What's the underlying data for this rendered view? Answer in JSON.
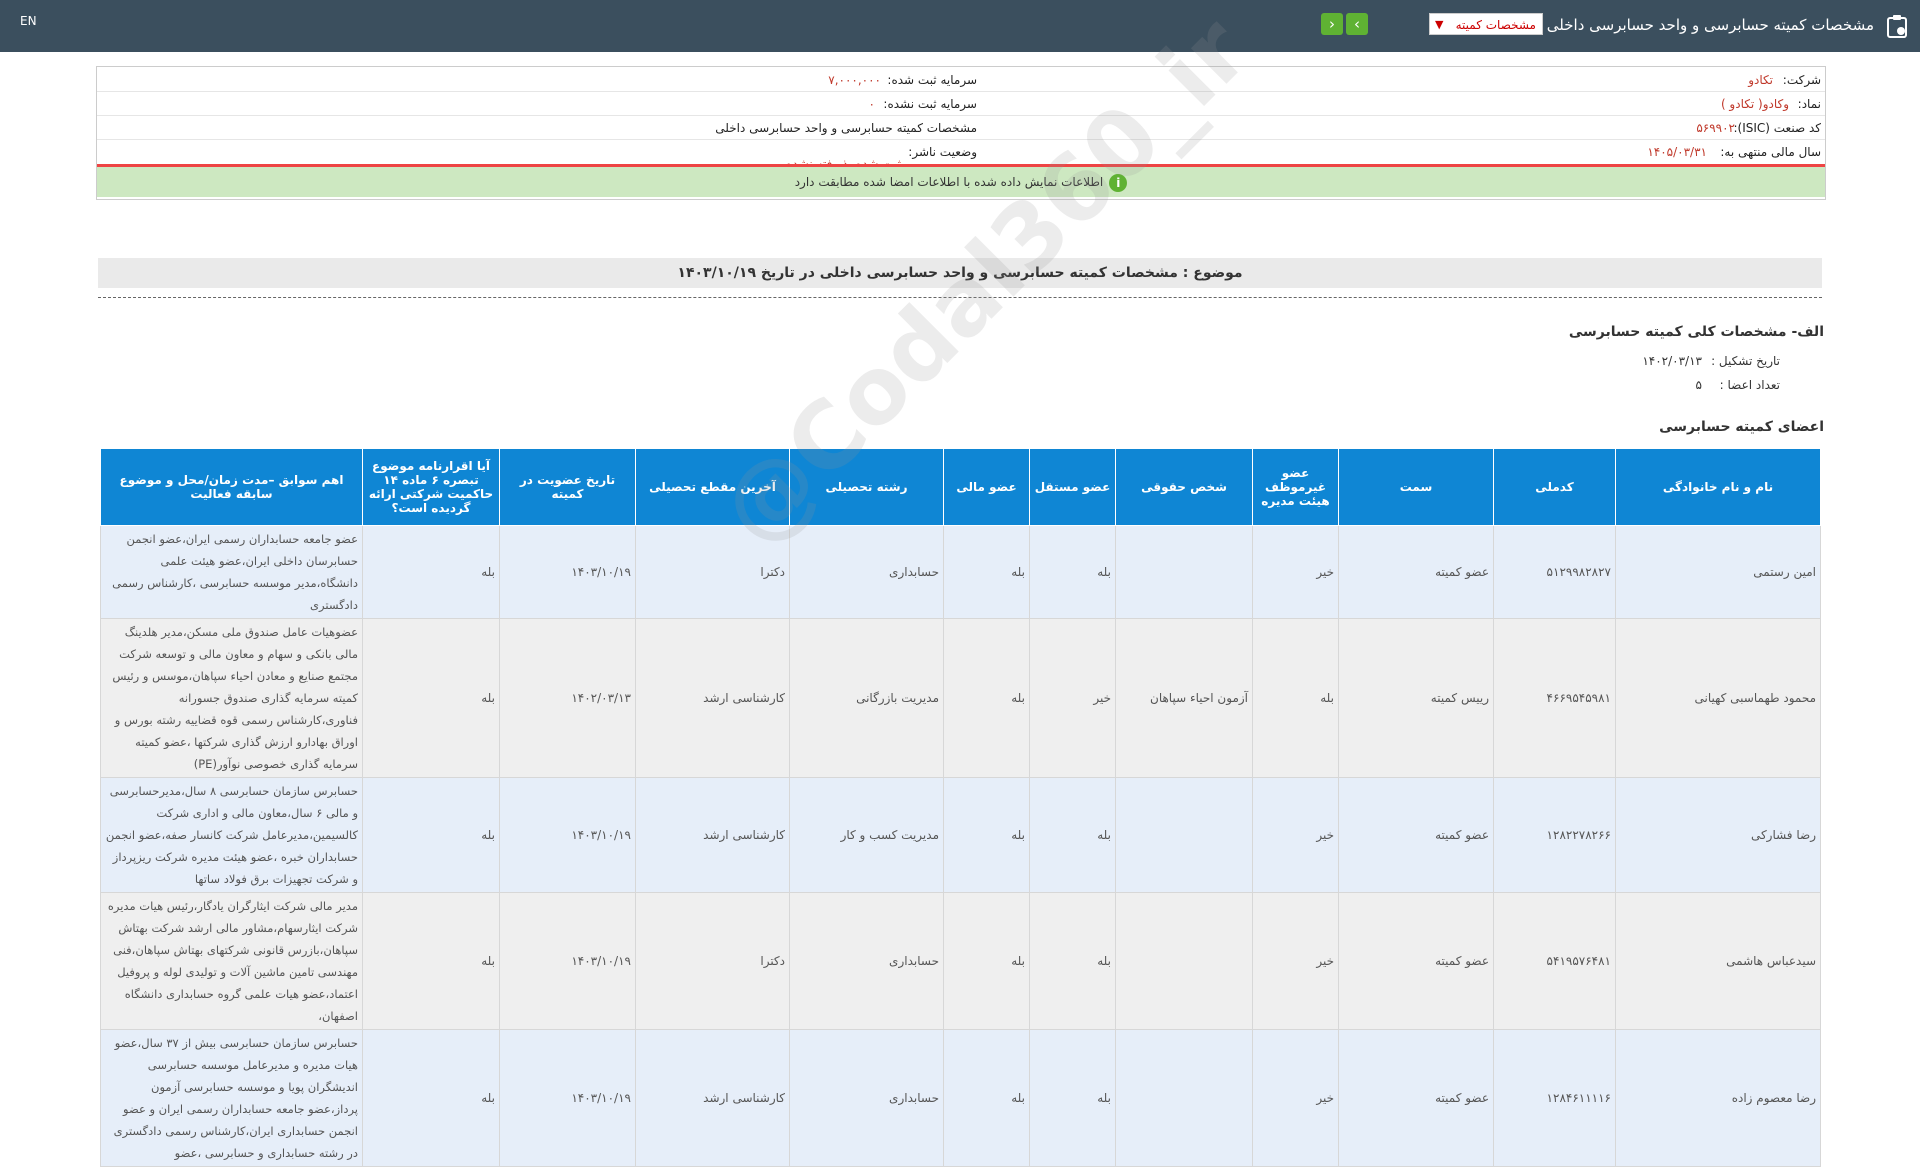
{
  "topbar": {
    "title": "مشخصات کمیته حسابرسی و واحد حسابرسی داخلی",
    "selector": "مشخصات کمیته",
    "lang": "EN"
  },
  "info": {
    "company_label": "شرکت:",
    "company_value": "تکادو",
    "symbol_label": "نماد:",
    "symbol_value": "وکادو( تکادو )",
    "isic_label": "کد صنعت (ISIC):",
    "isic_value": "۵۶۹۹۰۲",
    "fiscal_label": "سال مالی منتهی به:",
    "fiscal_value": "۱۴۰۵/۰۳/۳۱",
    "reg_capital_label": "سرمایه ثبت شده:",
    "reg_capital_value": "۷,۰۰۰,۰۰۰",
    "unreg_capital_label": "سرمایه ثبت نشده:",
    "unreg_capital_value": "۰",
    "report_type": "مشخصات کمیته حسابرسی و واحد حسابرسی داخلی",
    "publisher_status_label": "وضعیت ناشر:",
    "publisher_status_value": "ثبت شده پذیرفته نشده",
    "notice": "اطلاعات نمایش داده شده با اطلاعات امضا شده مطابقت دارد"
  },
  "subject": "موضوع : مشخصات کمیته حسابرسی و واحد حسابرسی داخلی در تاریخ ۱۴۰۳/۱۰/۱۹",
  "section_a": {
    "title": "الف- مشخصات کلی کمیته حسابرسی",
    "formation_label": "تاریخ تشکیل :",
    "formation_value": "۱۴۰۲/۰۳/۱۳",
    "members_count_label": "تعداد اعضا :",
    "members_count_value": "۵"
  },
  "section_b_title": "اعضای کمیته حسابرسی",
  "watermark": "@Codal360_ir",
  "table": {
    "headers": [
      "نام و نام خانوادگی",
      "کدملی",
      "سمت",
      "عضو غیرموظف هیئت مدیره",
      "شخص حقوقی",
      "عضو مستقل",
      "عضو مالی",
      "رشته تحصیلی",
      "آخرین مقطع تحصیلی",
      "تاریخ عضویت در کمیته",
      "آیا اقرارنامه موضوع تبصره ۶ ماده ۱۴ حاکمیت شرکتی ارائه گردیده است؟",
      "اهم سوابق –مدت زمان/محل و موضوع سابقه فعالیت"
    ],
    "rows": [
      {
        "name": "امین رستمی",
        "code": "۵۱۲۹۹۸۲۸۲۷",
        "role": "عضو کمیته",
        "nonexec": "خیر",
        "legal": "",
        "independent": "بله",
        "financial": "بله",
        "field": "حسابداری",
        "degree": "دکترا",
        "date": "۱۴۰۳/۱۰/۱۹",
        "declaration": "بله",
        "history": "عضو جامعه حسابداران رسمی ایران،عضو انجمن حسابرسان داخلی ایران،عضو هیئت علمی دانشگاه،مدیر موسسه حسابرسی ،کارشناس رسمی دادگستری"
      },
      {
        "name": "محمود طهماسبی کهیانی",
        "code": "۴۶۶۹۵۴۵۹۸۱",
        "role": "رییس کمیته",
        "nonexec": "بله",
        "legal": "آزمون احیاء سپاهان",
        "independent": "خیر",
        "financial": "بله",
        "field": "مدیریت بازرگانی",
        "degree": "کارشناسی ارشد",
        "date": "۱۴۰۲/۰۳/۱۳",
        "declaration": "بله",
        "history": "عضوهیات عامل صندوق ملی مسکن،مدیر هلدینگ مالی بانکی و سهام و معاون مالی و توسعه شرکت مجتمع صنایع و معادن احیاء سپاهان،موسس و رئیس کمیته سرمایه گذاری صندوق جسورانه فناوری،کارشناس رسمی قوه قضاییه رشته بورس و اوراق بهادارو ارزش گذاری شرکتها ،عضو کمیته سرمایه گذاری خصوصی نوآور(PE)"
      },
      {
        "name": "رضا فشارکی",
        "code": "۱۲۸۲۲۷۸۲۶۶",
        "role": "عضو کمیته",
        "nonexec": "خیر",
        "legal": "",
        "independent": "بله",
        "financial": "بله",
        "field": "مدیریت کسب و کار",
        "degree": "کارشناسی ارشد",
        "date": "۱۴۰۳/۱۰/۱۹",
        "declaration": "بله",
        "history": "حسابرس سازمان حسابرسی ۸ سال،مدیرحسابرسی و مالی ۶ سال،معاون مالی و اداری شرکت کالسیمین،مدیرعامل شرکت کانسار صفه،عضو انجمن حسابداران خبره ،عضو هیئت مدیره شرکت ریزپرداز و شرکت تجهیزات برق فولاد ساتها"
      },
      {
        "name": "سیدعباس هاشمی",
        "code": "۵۴۱۹۵۷۶۴۸۱",
        "role": "عضو کمیته",
        "nonexec": "خیر",
        "legal": "",
        "independent": "بله",
        "financial": "بله",
        "field": "حسابداری",
        "degree": "دکترا",
        "date": "۱۴۰۳/۱۰/۱۹",
        "declaration": "بله",
        "history": "مدیر مالی شرکت ایثارگران یادگار،رئیس هیات مدیره شرکت ایثارسهام،مشاور مالی ارشد شرکت بهتاش سپاهان،بازرس قانونی شرکتهای بهتاش سپاهان،فنی مهندسی تامین ماشین آلات و تولیدی لوله و پروفیل اعتماد،عضو هیات علمی گروه حسابداری دانشگاه اصفهان،"
      },
      {
        "name": "رضا معصوم زاده",
        "code": "۱۲۸۴۶۱۱۱۱۶",
        "role": "عضو کمیته",
        "nonexec": "خیر",
        "legal": "",
        "independent": "بله",
        "financial": "بله",
        "field": "حسابداری",
        "degree": "کارشناسی ارشد",
        "date": "۱۴۰۳/۱۰/۱۹",
        "declaration": "بله",
        "history": "حسابرس سازمان حسابرسی بیش از ۳۷ سال،عضو هیات مدیره و مدیرعامل موسسه حسابرسی اندیشگران پویا و موسسه حسابرسی آزمون پرداز،عضو جامعه حسابداران رسمی ایران و عضو انجمن حسابداری ایران،کارشناس رسمی دادگستری در رشته حسابداری و حسابرسی ،عضو"
      }
    ]
  },
  "colors": {
    "topbar": "#3b4f5e",
    "header_blue": "#0f86d4",
    "notice_green": "#cde8c1",
    "accent_red": "#c0392b",
    "nav_green": "#5fb233"
  }
}
